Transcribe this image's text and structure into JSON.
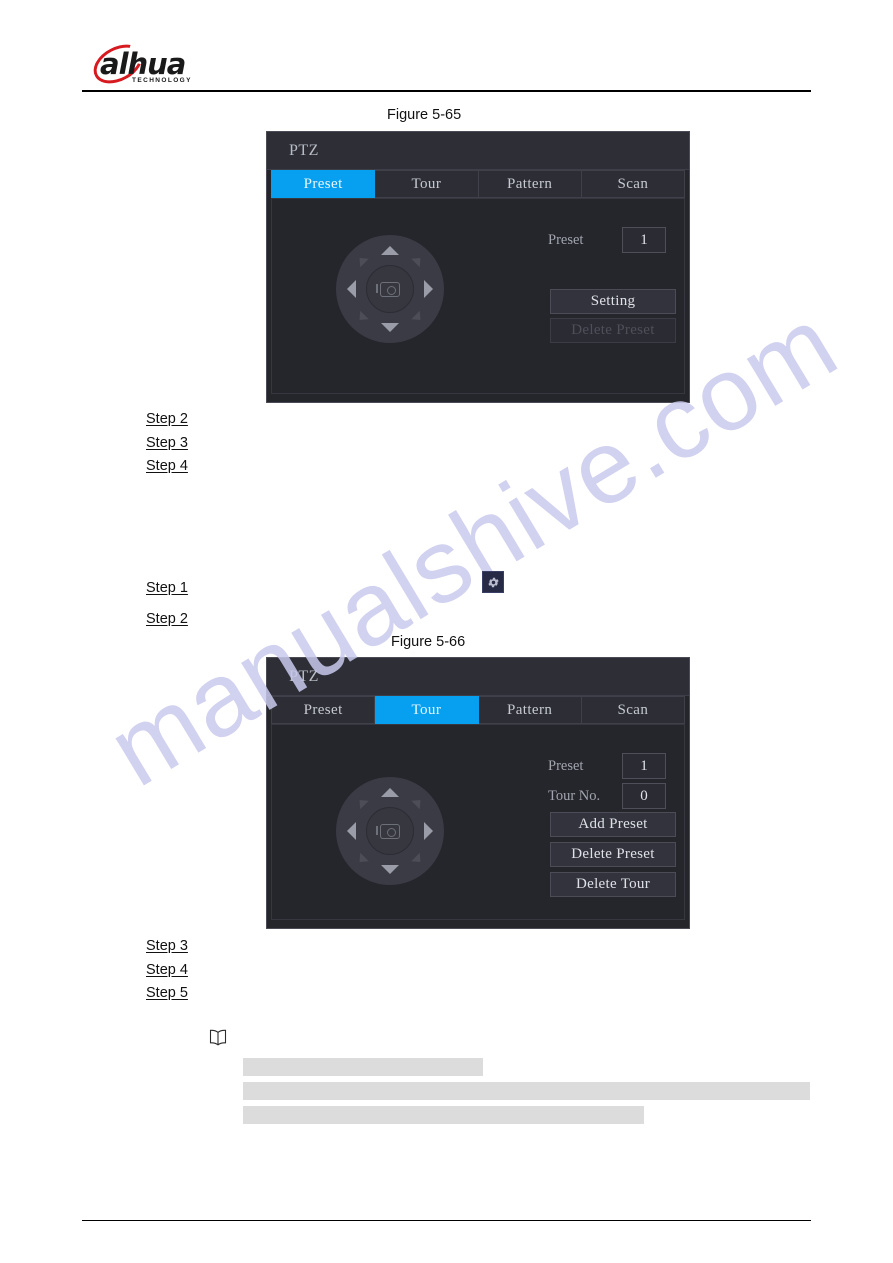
{
  "page": {
    "brand": {
      "name": "alhua",
      "word_a": "a",
      "word_rest": "hua",
      "tagline": "TECHNOLOGY"
    }
  },
  "figures": [
    {
      "caption": "Figure 5-65",
      "dialog": {
        "title": "PTZ",
        "tabs": [
          {
            "label": "Preset",
            "active": true
          },
          {
            "label": "Tour",
            "active": false
          },
          {
            "label": "Pattern",
            "active": false
          },
          {
            "label": "Scan",
            "active": false
          }
        ],
        "joystick": {
          "icon": "ptz-dpad-icon",
          "center_icon": "camera-zoom-icon",
          "directions": [
            "up",
            "down",
            "left",
            "right",
            "up-left",
            "up-right",
            "down-left",
            "down-right"
          ]
        },
        "fields": [
          {
            "label": "Preset",
            "value": "1"
          }
        ],
        "buttons": [
          {
            "label": "Setting",
            "disabled": false
          },
          {
            "label": "Delete Preset",
            "disabled": true
          }
        ]
      }
    },
    {
      "caption": "Figure 5-66",
      "dialog": {
        "title": "PTZ",
        "tabs": [
          {
            "label": "Preset",
            "active": false
          },
          {
            "label": "Tour",
            "active": true
          },
          {
            "label": "Pattern",
            "active": false
          },
          {
            "label": "Scan",
            "active": false
          }
        ],
        "joystick": {
          "icon": "ptz-dpad-icon",
          "center_icon": "camera-zoom-icon",
          "directions": [
            "up",
            "down",
            "left",
            "right",
            "up-left",
            "up-right",
            "down-left",
            "down-right"
          ]
        },
        "fields": [
          {
            "label": "Preset",
            "value": "1"
          },
          {
            "label": "Tour No.",
            "value": "0"
          }
        ],
        "buttons": [
          {
            "label": "Add Preset",
            "disabled": false
          },
          {
            "label": "Delete Preset",
            "disabled": false
          },
          {
            "label": "Delete Tour",
            "disabled": false
          }
        ]
      }
    }
  ],
  "steps_group_1": [
    {
      "label": "Step 2"
    },
    {
      "label": "Step 3"
    },
    {
      "label": "Step 4"
    }
  ],
  "steps_group_2": [
    {
      "label": "Step 1"
    },
    {
      "label": "Step 2"
    }
  ],
  "steps_group_3": [
    {
      "label": "Step 3"
    },
    {
      "label": "Step 4"
    },
    {
      "label": "Step 5"
    }
  ],
  "inline_gear": {
    "icon": "gear-icon"
  },
  "note": {
    "icon": "open-book-icon"
  },
  "watermark": {
    "text": "manualshive.com"
  },
  "colors": {
    "accent_blue": "#07a0f0",
    "brand_red": "#d71920",
    "dialog_bg": "#25262c",
    "titlebar_bg": "#2d2e36",
    "tab_bg": "#2c2d35",
    "redaction_gray": "#dcdcdc",
    "watermark_color": "#c9c9ee"
  }
}
